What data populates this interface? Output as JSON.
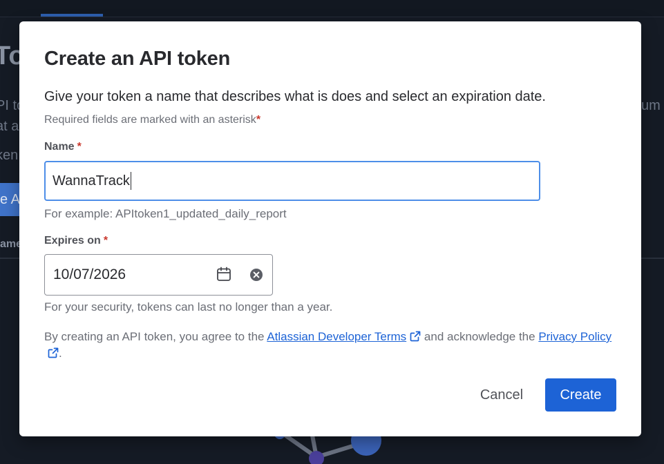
{
  "background": {
    "heading_fragment": "To",
    "text_fragments": [
      "PI to",
      "at a",
      "ken",
      "um o"
    ],
    "button_fragment": "e A",
    "table_header_fragment": "ame"
  },
  "modal": {
    "title": "Create an API token",
    "description": "Give your token a name that describes what is does and select an expiration date.",
    "required_note": "Required fields are marked with an asterisk",
    "asterisk": "*",
    "name_field": {
      "label": "Name",
      "value": "WannaTrack",
      "helper": "For example: APItoken1_updated_daily_report"
    },
    "expires_field": {
      "label": "Expires on",
      "value": "10/07/2026",
      "helper": "For your security, tokens can last no longer than a year."
    },
    "terms": {
      "prefix": "By creating an API token, you agree to the",
      "developer_terms_link": "Atlassian Developer Terms",
      "middle": "and acknowledge the",
      "privacy_link": "Privacy Policy",
      "suffix": "."
    },
    "buttons": {
      "cancel": "Cancel",
      "create": "Create"
    }
  },
  "colors": {
    "primary": "#1d63d6",
    "required": "#c9372c",
    "focus_border": "#4d8ee8",
    "text": "#292a2e",
    "subtle_text": "#6b6e76"
  },
  "icons": [
    "calendar-icon",
    "clear-icon",
    "external-link-icon"
  ]
}
